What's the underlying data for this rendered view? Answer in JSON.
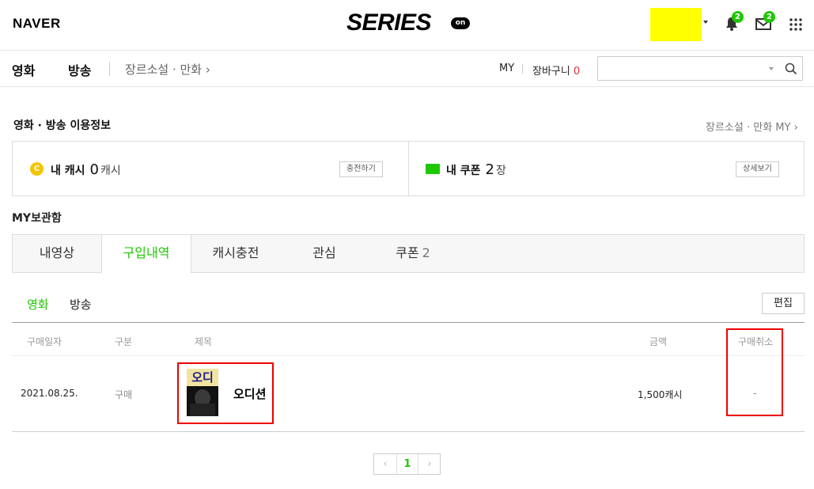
{
  "header": {
    "naver_logo": "NAVER",
    "series_logo": "SERIES",
    "series_on": "on",
    "notifications_count": "2",
    "messages_count": "2"
  },
  "nav": {
    "movie": "영화",
    "broadcast": "방송",
    "genre_link": "장르소설 · 만화 ›",
    "my": "MY",
    "cart_label": "장바구니",
    "cart_count": "0",
    "search_placeholder": ""
  },
  "usage": {
    "title": "영화 · 방송 이용정보",
    "genre_my_link": "장르소설 · 만화 MY ›",
    "cash_label": "내 캐시",
    "cash_amount": "0",
    "cash_unit": "캐시",
    "charge_button": "충전하기",
    "coupon_label": "내 쿠폰",
    "coupon_amount": "2",
    "coupon_unit": "장",
    "detail_button": "상세보기"
  },
  "storage": {
    "title": "MY보관함",
    "tabs": [
      {
        "label": "내영상",
        "count": ""
      },
      {
        "label": "구입내역",
        "count": ""
      },
      {
        "label": "캐시충전",
        "count": ""
      },
      {
        "label": "관심",
        "count": ""
      },
      {
        "label": "쿠폰",
        "count": "2"
      }
    ],
    "subtabs": [
      "영화",
      "방송"
    ],
    "edit_button": "편집"
  },
  "table": {
    "headers": [
      "구매일자",
      "구분",
      "제목",
      "금액",
      "구매취소"
    ],
    "rows": [
      {
        "date": "2021.08.25.",
        "type": "구매",
        "title": "오디션",
        "price": "1,500캐시",
        "cancel": "-",
        "poster_text": "오디"
      }
    ]
  },
  "pagination": {
    "prev": "‹",
    "current": "1",
    "next": "›"
  },
  "colors": {
    "accent_green": "#1ec800",
    "highlight_red": "#ee0000",
    "user_block_yellow": "#ffff00"
  }
}
